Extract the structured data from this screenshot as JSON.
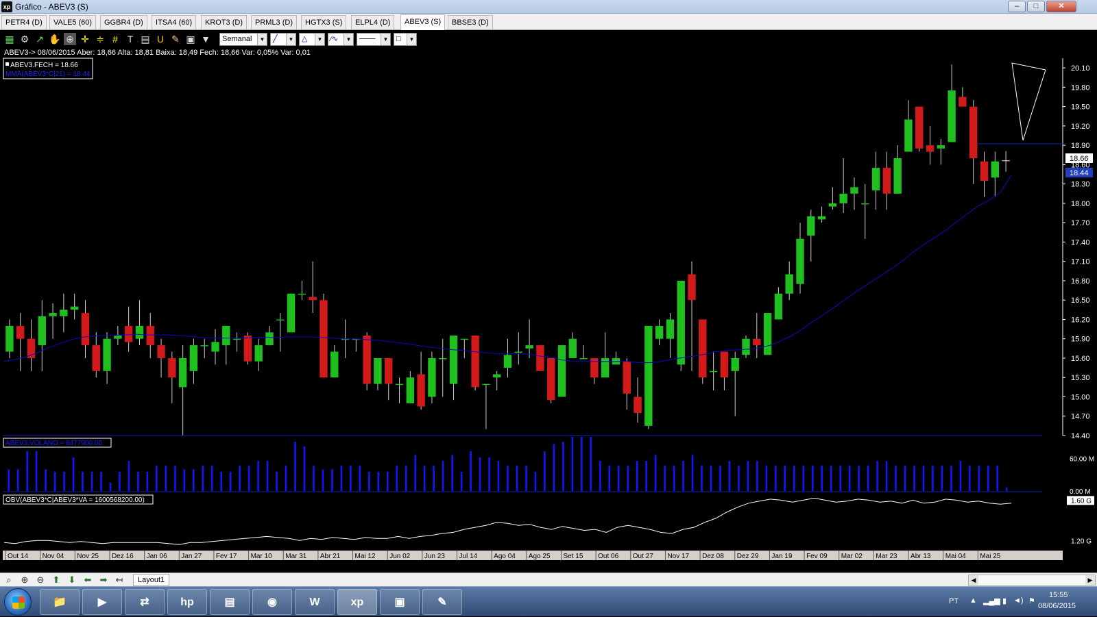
{
  "window": {
    "title": "Gráfico - ABEV3 (S)",
    "app_icon_text": "xp",
    "buttons": [
      "–",
      "□",
      "✕"
    ]
  },
  "tabs": [
    "PETR4 (D)",
    "VALE5 (60)",
    "GGBR4 (D)",
    "ITSA4 (60)",
    "KROT3 (D)",
    "PRML3 (D)",
    "HGTX3 (S)",
    "ELPL4 (D)",
    "ABEV3 (S)",
    "BBSE3 (D)"
  ],
  "active_tab": "ABEV3 (S)",
  "toolbar": {
    "period_select": "Semanal",
    "icons": [
      "chart-icon",
      "gear-icon",
      "indicator-icon",
      "hand-icon",
      "zoom-select-icon",
      "crosshair-icon",
      "horizontal-lines-icon",
      "grid-lines-icon",
      "text-icon",
      "calculator-icon",
      "magnet-icon",
      "eraser-icon",
      "clipboard-icon",
      "filter-icon"
    ]
  },
  "info_line": "ABEV3-> 08/06/2015 Aber: 18,66 Alta: 18,81 Baixa: 18,49 Fech: 18,66 Var: 0,05% Var: 0,01",
  "legend": {
    "close_label": "ABEV3.FECH = 18.66",
    "mma_label": "MMA(ABEV3*C|21) = 18.44"
  },
  "price_labels": {
    "last": "18.66",
    "mma": "18.44"
  },
  "volume_label": "ABEV3.VOLANO = 8477900.00",
  "obv_label": "OBV(ABEV3*C|ABEV3*VA = 1600568200.00)",
  "bottom": {
    "layout_tab": "Layout1"
  },
  "taskbar": {
    "lang": "PT",
    "time": "15:55",
    "date": "08/06/2015",
    "apps": [
      "explorer",
      "media",
      "network",
      "hp",
      "app",
      "chrome",
      "word",
      "xp",
      "photo",
      "paint"
    ]
  },
  "colors": {
    "up": "#1fbf1f",
    "down": "#d21a1a",
    "mma": "#0a0ac8",
    "volume": "#1515ff",
    "obv": "#ffffff",
    "separator": "#1020c0"
  },
  "chart_data": [
    {
      "type": "candlestick",
      "title": "ABEV3",
      "y_ticks": [
        "20.10",
        "19.80",
        "19.50",
        "19.20",
        "18.90",
        "18.60",
        "18.30",
        "18.00",
        "17.70",
        "17.40",
        "17.10",
        "16.80",
        "16.50",
        "16.20",
        "15.90",
        "15.60",
        "15.30",
        "15.00",
        "14.70",
        "14.40"
      ],
      "ylim": [
        14.4,
        20.25
      ],
      "x_ticks": [
        "Out 14",
        "Nov 04",
        "Nov 25",
        "Dez 16",
        "Jan 06",
        "Jan 27",
        "Fev 17",
        "Mar 10",
        "Mar 31",
        "Abr 21",
        "Mai 12",
        "Jun 02",
        "Jun 23",
        "Jul 14",
        "Ago 04",
        "Ago 25",
        "Set 15",
        "Out 06",
        "Out 27",
        "Nov 17",
        "Dez 08",
        "Dez 29",
        "Jan 19",
        "Fev 09",
        "Mar 02",
        "Mar 23",
        "Abr 13",
        "Mai 04",
        "Mai 25"
      ],
      "candles": [
        [
          15.7,
          16.1,
          16.2,
          15.6
        ],
        [
          16.1,
          15.9,
          16.3,
          15.4
        ],
        [
          15.9,
          15.6,
          16.2,
          15.4
        ],
        [
          15.8,
          16.25,
          16.5,
          15.4
        ],
        [
          16.25,
          16.3,
          16.45,
          15.9
        ],
        [
          16.25,
          16.35,
          16.6,
          16.0
        ],
        [
          16.35,
          16.4,
          16.6,
          16.2
        ],
        [
          16.3,
          15.8,
          16.5,
          15.6
        ],
        [
          15.8,
          15.4,
          16.0,
          15.3
        ],
        [
          15.4,
          15.9,
          16.0,
          15.2
        ],
        [
          15.9,
          15.95,
          16.1,
          15.8
        ],
        [
          16.1,
          15.85,
          16.4,
          15.7
        ],
        [
          15.9,
          16.1,
          16.5,
          15.8
        ],
        [
          16.1,
          15.8,
          16.3,
          15.6
        ],
        [
          15.8,
          15.6,
          15.9,
          15.3
        ],
        [
          15.6,
          15.3,
          15.7,
          14.9
        ],
        [
          15.15,
          15.6,
          15.8,
          14.4
        ],
        [
          15.4,
          15.8,
          15.9,
          15.2
        ],
        [
          15.8,
          15.8,
          15.9,
          15.6
        ],
        [
          15.7,
          15.85,
          16.05,
          15.5
        ],
        [
          15.8,
          16.1,
          16.1,
          15.5
        ],
        [
          15.9,
          15.9,
          16.0,
          15.7
        ],
        [
          15.95,
          15.55,
          16.0,
          15.5
        ],
        [
          15.55,
          15.8,
          15.9,
          15.4
        ],
        [
          15.8,
          16.0,
          16.1,
          15.8
        ],
        [
          16.2,
          16.2,
          16.3,
          15.7
        ],
        [
          16.0,
          16.6,
          16.6,
          16.0
        ],
        [
          16.6,
          16.6,
          16.8,
          16.5
        ],
        [
          16.55,
          16.5,
          17.1,
          16.3
        ],
        [
          16.5,
          15.3,
          16.6,
          15.3
        ],
        [
          15.3,
          15.7,
          15.8,
          15.4
        ],
        [
          15.9,
          15.9,
          16.2,
          15.6
        ],
        [
          15.9,
          15.9,
          15.9,
          15.7
        ],
        [
          15.95,
          15.2,
          16.0,
          15.1
        ],
        [
          15.2,
          15.6,
          15.6,
          15.1
        ],
        [
          15.6,
          15.2,
          15.6,
          14.95
        ],
        [
          15.2,
          15.2,
          15.3,
          14.9
        ],
        [
          14.9,
          15.3,
          15.4,
          14.9
        ],
        [
          15.35,
          14.85,
          15.7,
          14.8
        ],
        [
          15.0,
          15.6,
          15.7,
          14.9
        ],
        [
          15.6,
          15.6,
          15.9,
          15.0
        ],
        [
          15.2,
          15.95,
          15.95,
          14.95
        ],
        [
          15.9,
          15.9,
          15.9,
          15.6
        ],
        [
          15.95,
          15.15,
          15.9,
          15.1
        ],
        [
          15.2,
          15.2,
          15.2,
          14.5
        ],
        [
          15.3,
          15.35,
          15.4,
          15.1
        ],
        [
          15.45,
          15.65,
          15.9,
          15.3
        ],
        [
          15.7,
          15.7,
          16.0,
          15.5
        ],
        [
          15.75,
          15.8,
          16.2,
          15.6
        ],
        [
          15.8,
          15.4,
          15.8,
          15.4
        ],
        [
          15.6,
          14.95,
          15.6,
          14.9
        ],
        [
          15.0,
          15.8,
          15.8,
          15.0
        ],
        [
          15.6,
          15.9,
          16.0,
          15.7
        ],
        [
          15.6,
          15.6,
          15.8,
          15.6
        ],
        [
          15.6,
          15.3,
          15.6,
          15.2
        ],
        [
          15.3,
          15.6,
          16.0,
          15.3
        ],
        [
          15.5,
          15.6,
          15.7,
          15.5
        ],
        [
          15.55,
          15.05,
          15.6,
          14.8
        ],
        [
          15.0,
          14.75,
          15.3,
          14.6
        ],
        [
          14.55,
          16.1,
          16.1,
          14.5
        ],
        [
          15.9,
          16.1,
          16.2,
          15.8
        ],
        [
          15.9,
          16.2,
          16.3,
          15.6
        ],
        [
          15.5,
          16.8,
          16.8,
          15.4
        ],
        [
          16.9,
          16.5,
          17.1,
          15.4
        ],
        [
          16.2,
          15.3,
          16.2,
          15.2
        ],
        [
          15.4,
          15.4,
          15.7,
          15.1
        ],
        [
          15.7,
          15.3,
          15.7,
          15.1
        ],
        [
          15.4,
          15.6,
          15.7,
          14.7
        ],
        [
          15.65,
          15.9,
          15.95,
          15.6
        ],
        [
          15.9,
          15.8,
          16.3,
          15.6
        ],
        [
          15.65,
          16.3,
          16.3,
          15.7
        ],
        [
          16.2,
          16.6,
          16.7,
          16.2
        ],
        [
          16.6,
          16.9,
          17.1,
          16.5
        ],
        [
          16.75,
          17.45,
          17.7,
          16.6
        ],
        [
          17.5,
          17.8,
          17.9,
          17.1
        ],
        [
          17.75,
          17.8,
          17.95,
          17.7
        ],
        [
          17.95,
          18.0,
          18.25,
          17.9
        ],
        [
          18.0,
          18.15,
          18.7,
          17.85
        ],
        [
          18.15,
          18.25,
          18.4,
          17.9
        ],
        [
          18.0,
          18.0,
          18.3,
          17.45
        ],
        [
          18.2,
          18.55,
          18.8,
          17.9
        ],
        [
          18.55,
          18.15,
          18.8,
          17.9
        ],
        [
          18.15,
          18.7,
          18.9,
          18.2
        ],
        [
          18.8,
          19.3,
          19.6,
          18.85
        ],
        [
          19.5,
          18.85,
          19.5,
          18.8
        ],
        [
          18.9,
          18.8,
          19.2,
          18.6
        ],
        [
          18.85,
          18.9,
          19.0,
          18.6
        ],
        [
          18.95,
          19.75,
          20.15,
          18.95
        ],
        [
          19.65,
          19.5,
          19.8,
          19.5
        ],
        [
          19.5,
          18.7,
          19.6,
          18.3
        ],
        [
          18.65,
          18.35,
          18.8,
          18.1
        ],
        [
          18.4,
          18.65,
          18.8,
          18.1
        ],
        [
          18.66,
          18.66,
          18.81,
          18.49
        ]
      ],
      "mma": [
        15.55,
        15.58,
        15.62,
        15.68,
        15.76,
        15.82,
        15.88,
        15.92,
        15.94,
        15.95,
        15.95,
        15.96,
        15.97,
        15.96,
        15.96,
        15.96,
        15.95,
        15.94,
        15.92,
        15.91,
        15.91,
        15.91,
        15.91,
        15.92,
        15.92,
        15.92,
        15.93,
        15.93,
        15.93,
        15.92,
        15.91,
        15.9,
        15.9,
        15.89,
        15.88,
        15.86,
        15.84,
        15.82,
        15.79,
        15.77,
        15.75,
        15.73,
        15.72,
        15.7,
        15.68,
        15.67,
        15.67,
        15.67,
        15.66,
        15.63,
        15.61,
        15.57,
        15.55,
        15.55,
        15.55,
        15.55,
        15.55,
        15.55,
        15.53,
        15.53,
        15.55,
        15.58,
        15.61,
        15.63,
        15.66,
        15.7,
        15.72,
        15.73,
        15.74,
        15.76,
        15.8,
        15.87,
        15.95,
        16.06,
        16.18,
        16.29,
        16.41,
        16.53,
        16.65,
        16.76,
        16.87,
        16.98,
        17.1,
        17.24,
        17.36,
        17.47,
        17.58,
        17.71,
        17.84,
        17.96,
        18.05,
        18.17,
        18.44
      ],
      "volume_ticks": [
        "60.00 M",
        "0.00 M"
      ],
      "volume": [
        18,
        18,
        33,
        33,
        18,
        16,
        16,
        28,
        16,
        16,
        16,
        7,
        16,
        25,
        16,
        16,
        21,
        21,
        21,
        18,
        18,
        21,
        21,
        16,
        16,
        21,
        21,
        25,
        25,
        16,
        21,
        41,
        37,
        21,
        18,
        18,
        21,
        21,
        21,
        16,
        16,
        16,
        21,
        21,
        30,
        21,
        21,
        25,
        30,
        16,
        33,
        28,
        28,
        25,
        21,
        21,
        21,
        16,
        33,
        39,
        41,
        45,
        54,
        54,
        25,
        21,
        21,
        21,
        25,
        25,
        30,
        21,
        21,
        25,
        30,
        21,
        21,
        21,
        25,
        21,
        25,
        25,
        21,
        21,
        21,
        21,
        21,
        21,
        21,
        21,
        21,
        21,
        21,
        21,
        25,
        25,
        21,
        21,
        21,
        21,
        21,
        21,
        21,
        25,
        21,
        21,
        21,
        21,
        3
      ],
      "obv_ticks": [
        "1.60 G",
        "1.20 G"
      ],
      "obv": [
        1.18,
        1.17,
        1.19,
        1.2,
        1.2,
        1.19,
        1.18,
        1.19,
        1.18,
        1.17,
        1.18,
        1.18,
        1.18,
        1.18,
        1.18,
        1.17,
        1.16,
        1.18,
        1.18,
        1.19,
        1.2,
        1.21,
        1.22,
        1.23,
        1.24,
        1.23,
        1.22,
        1.2,
        1.22,
        1.21,
        1.23,
        1.22,
        1.21,
        1.23,
        1.22,
        1.22,
        1.24,
        1.22,
        1.24,
        1.25,
        1.27,
        1.28,
        1.31,
        1.33,
        1.35,
        1.38,
        1.37,
        1.35,
        1.36,
        1.33,
        1.31,
        1.34,
        1.32,
        1.3,
        1.31,
        1.28,
        1.33,
        1.35,
        1.33,
        1.31,
        1.28,
        1.27,
        1.31,
        1.33,
        1.38,
        1.42,
        1.48,
        1.53,
        1.57,
        1.59,
        1.61,
        1.6,
        1.58,
        1.6,
        1.62,
        1.6,
        1.58,
        1.59,
        1.61,
        1.6,
        1.58,
        1.59,
        1.57,
        1.6,
        1.57,
        1.58,
        1.61,
        1.6,
        1.58,
        1.59,
        1.57,
        1.56,
        1.57
      ]
    }
  ]
}
